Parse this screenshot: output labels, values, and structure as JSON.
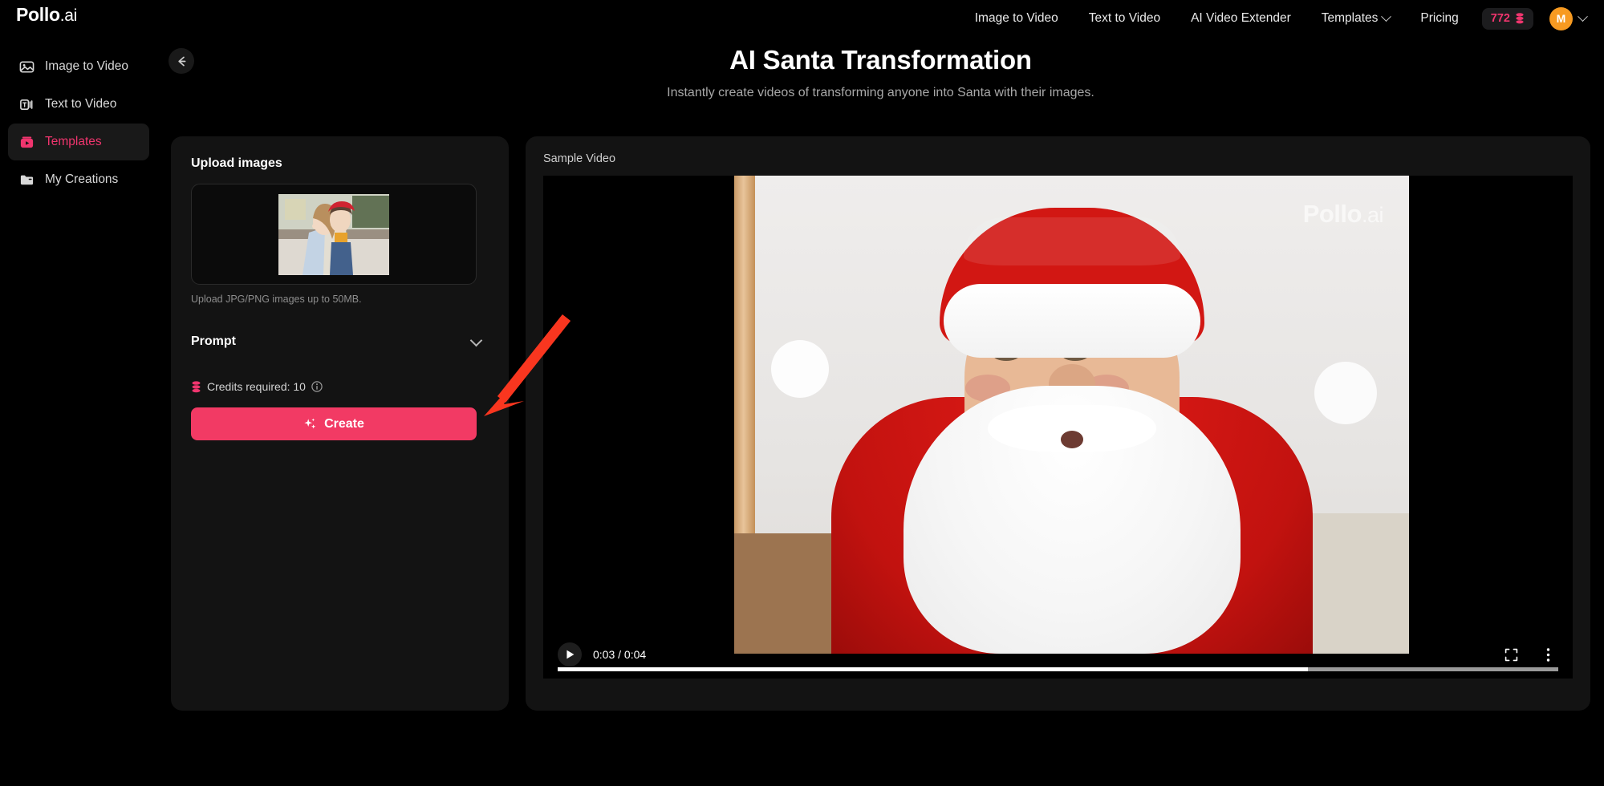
{
  "brand": {
    "name": "Pollo",
    "suffix": ".ai"
  },
  "header": {
    "nav": [
      {
        "label": "Image to Video"
      },
      {
        "label": "Text to Video"
      },
      {
        "label": "AI Video Extender"
      },
      {
        "label": "Templates",
        "has_chevron": true
      },
      {
        "label": "Pricing"
      }
    ],
    "credits": {
      "value": "772",
      "icon": "coin-icon",
      "color": "#f0356e"
    },
    "account": {
      "initial": "M",
      "avatar_color": "#f79a21",
      "chevron": "chevron-down-icon"
    }
  },
  "sidebar": {
    "items": [
      {
        "label": "Image to Video",
        "icon": "image-to-video-icon",
        "active": false
      },
      {
        "label": "Text to Video",
        "icon": "text-to-video-icon",
        "active": false
      },
      {
        "label": "Templates",
        "icon": "templates-icon",
        "active": true
      },
      {
        "label": "My Creations",
        "icon": "folder-icon",
        "active": false
      }
    ],
    "active_color": "#f0356e"
  },
  "back_button": {
    "icon": "arrow-left-icon"
  },
  "page": {
    "title": "AI Santa Transformation",
    "subtitle": "Instantly create videos of transforming anyone into Santa with their images."
  },
  "left_panel": {
    "upload": {
      "title": "Upload images",
      "hint": "Upload JPG/PNG images up to 50MB.",
      "thumbnail_alt": "two-women-photo-thumbnail"
    },
    "prompt": {
      "label": "Prompt",
      "chevron": "chevron-down-icon",
      "expanded": false
    },
    "credits": {
      "text": "Credits required: 10",
      "coin_icon": "coin-icon",
      "info_icon": "info-icon"
    },
    "create_button": {
      "label": "Create",
      "icon": "sparkle-icon",
      "color": "#f23a64"
    }
  },
  "right_panel": {
    "label": "Sample Video",
    "video": {
      "watermark": {
        "name": "Pollo",
        "suffix": ".ai"
      },
      "time_display": "0:03 / 0:04",
      "current_time": "0:03",
      "duration": "0:04",
      "progress_percent": 75,
      "play_icon": "play-icon",
      "fullscreen_icon": "fullscreen-icon",
      "more_options_icon": "more-vertical-icon",
      "scene_alt": "santa-claus-portrait"
    }
  },
  "annotation": {
    "arrow_color": "#f9361f",
    "points_to": "create-button"
  }
}
